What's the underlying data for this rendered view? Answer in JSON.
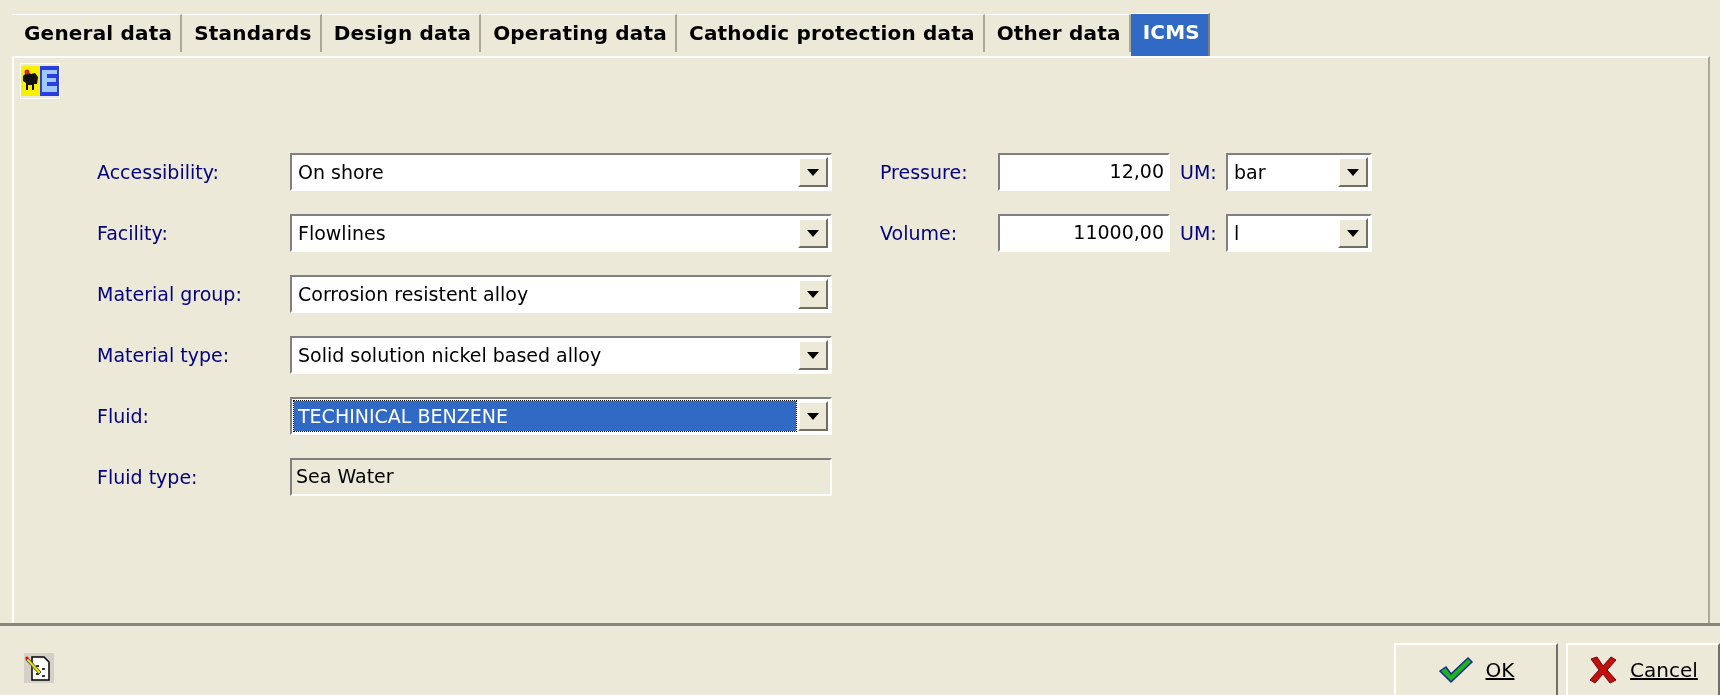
{
  "tabs": [
    {
      "label": "General data",
      "selected": false
    },
    {
      "label": "Standards",
      "selected": false
    },
    {
      "label": "Design data",
      "selected": false
    },
    {
      "label": "Operating data",
      "selected": false
    },
    {
      "label": "Cathodic protection data",
      "selected": false
    },
    {
      "label": "Other data",
      "selected": false
    },
    {
      "label": "ICMS",
      "selected": true
    }
  ],
  "left_fields": [
    {
      "label": "Accessibility:",
      "kind": "combo",
      "value": "On shore",
      "focused": false
    },
    {
      "label": "Facility:",
      "kind": "combo",
      "value": "Flowlines",
      "focused": false
    },
    {
      "label": "Material group:",
      "kind": "combo",
      "value": "Corrosion resistent alloy",
      "focused": false
    },
    {
      "label": "Material type:",
      "kind": "combo",
      "value": "Solid solution nickel based alloy",
      "focused": false
    },
    {
      "label": "Fluid:",
      "kind": "combo",
      "value": "TECHINICAL BENZENE",
      "focused": true
    },
    {
      "label": "Fluid type:",
      "kind": "readonly",
      "value": "Sea Water"
    }
  ],
  "right_fields": [
    {
      "label": "Pressure:",
      "value": "12,00",
      "unit_label": "UM:",
      "unit": "bar"
    },
    {
      "label": "Volume:",
      "value": "11000,00",
      "unit_label": "UM:",
      "unit": "l"
    }
  ],
  "buttons": [
    {
      "label": "OK",
      "kind": "ok"
    },
    {
      "label": "Cancel",
      "kind": "cancel"
    }
  ]
}
